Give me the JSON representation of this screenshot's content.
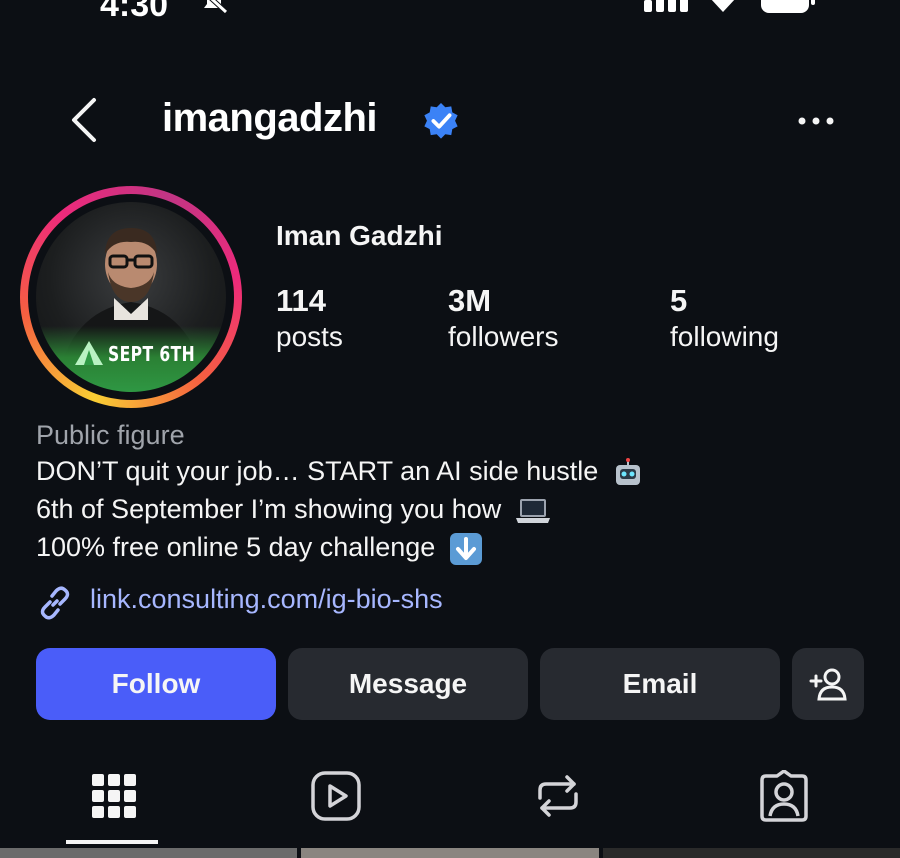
{
  "status_bar": {
    "time": "4:30"
  },
  "header": {
    "username": "imangadzhi"
  },
  "profile": {
    "avatar_badge_text": "SEPT 6TH",
    "full_name": "Iman Gadzhi",
    "stats": [
      {
        "value": "114",
        "label": "posts"
      },
      {
        "value": "3M",
        "label": "followers"
      },
      {
        "value": "5",
        "label": "following"
      }
    ],
    "category": "Public figure",
    "bio": [
      "DON’T quit your job… START an AI side hustle",
      "6th of September I’m showing you how",
      "100% free online 5 day challenge"
    ],
    "link": "link.consulting.com/ig-bio-shs"
  },
  "actions": {
    "follow": "Follow",
    "message": "Message",
    "email": "Email"
  },
  "tabs": [
    "grid-icon",
    "reels-icon",
    "reposts-icon",
    "tagged-icon"
  ],
  "colors": {
    "background": "#0c0f14",
    "follow_button": "#4a5df9",
    "secondary_button": "#272a30",
    "link": "#a7b7ff",
    "verified": "#3b82f6"
  }
}
